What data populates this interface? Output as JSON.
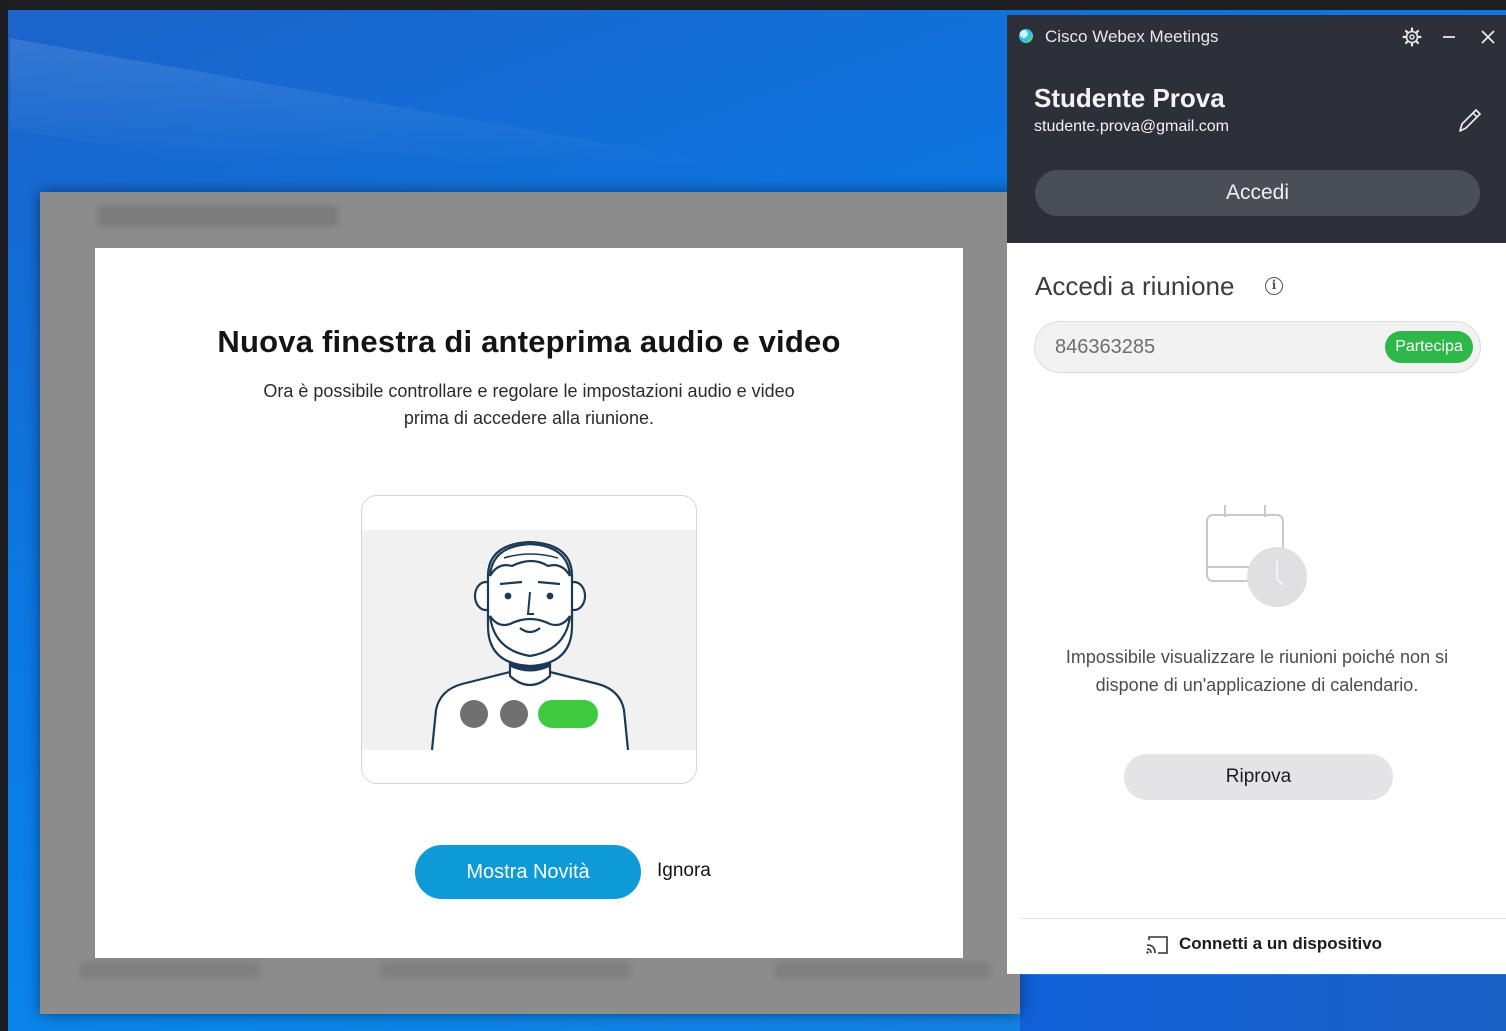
{
  "dialog": {
    "title": "Nuova finestra di anteprima audio e video",
    "body_line1": "Ora è possibile controllare e regolare le impostazioni audio e video",
    "body_line2": "prima di accedere alla riunione.",
    "primary_button": "Mostra Novità",
    "secondary_button": "Ignora"
  },
  "webex": {
    "app_title": "Cisco Webex Meetings",
    "user_name": "Studente Prova",
    "user_email": "studente.prova@gmail.com",
    "signin_button": "Accedi",
    "join_title": "Accedi a riunione",
    "meeting_number": "846363285",
    "join_button": "Partecipa",
    "empty_line1": "Impossibile visualizzare le riunioni poiché non si",
    "empty_line2": "dispone di un'applicazione di calendario.",
    "retry_button": "Riprova",
    "connect_label": "Connetti a un dispositivo"
  },
  "icons": [
    "webex-logo-icon",
    "gear-icon",
    "minimize-icon",
    "close-icon",
    "pencil-icon",
    "info-icon",
    "calendar-clock-icon",
    "cast-icon"
  ],
  "colors": {
    "accent_blue": "#0d9ad6",
    "join_green": "#2fb84a",
    "panel_dark": "#2d3038"
  }
}
